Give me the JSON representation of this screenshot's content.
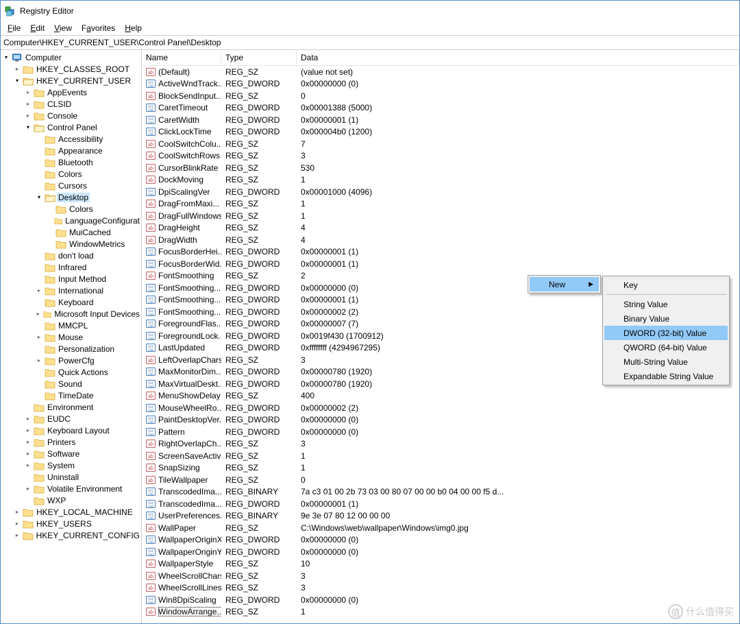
{
  "window": {
    "title": "Registry Editor"
  },
  "menu": {
    "file": "File",
    "edit": "Edit",
    "view": "View",
    "favorites": "Favorites",
    "help": "Help"
  },
  "addressbar": "Computer\\HKEY_CURRENT_USER\\Control Panel\\Desktop",
  "tree": {
    "root": "Computer",
    "hkcr": "HKEY_CLASSES_ROOT",
    "hkcu": "HKEY_CURRENT_USER",
    "hkcu_children": [
      "AppEvents",
      "CLSID",
      "Console"
    ],
    "control_panel": "Control Panel",
    "cp_children_pre": [
      "Accessibility",
      "Appearance",
      "Bluetooth",
      "Colors",
      "Cursors"
    ],
    "desktop": "Desktop",
    "desktop_children": [
      "Colors",
      "LanguageConfigurat",
      "MuiCached",
      "WindowMetrics"
    ],
    "cp_children_post": [
      "don't load",
      "Infrared",
      "Input Method",
      "International",
      "Keyboard",
      "Microsoft Input Devices",
      "MMCPL",
      "Mouse",
      "Personalization",
      "PowerCfg",
      "Quick Actions",
      "Sound",
      "TimeDate"
    ],
    "hkcu_children_post": [
      "Environment",
      "EUDC",
      "Keyboard Layout",
      "Printers",
      "Software",
      "System",
      "Uninstall",
      "Volatile Environment",
      "WXP"
    ],
    "hklm": "HKEY_LOCAL_MACHINE",
    "hku": "HKEY_USERS",
    "hkcc": "HKEY_CURRENT_CONFIG",
    "expandables_post": {
      "EUDC": true,
      "Keyboard Layout": true,
      "Printers": true,
      "Software": true,
      "System": true,
      "Volatile Environment": true
    },
    "cp_expandables_post": {
      "International": true,
      "Microsoft Input Devices": true,
      "Mouse": true,
      "PowerCfg": true
    }
  },
  "columns": {
    "name": "Name",
    "type": "Type",
    "data": "Data"
  },
  "values": [
    {
      "icon": "ab",
      "name": "(Default)",
      "type": "REG_SZ",
      "data": "(value not set)"
    },
    {
      "icon": "bin",
      "name": "ActiveWndTrack...",
      "type": "REG_DWORD",
      "data": "0x00000000 (0)"
    },
    {
      "icon": "ab",
      "name": "BlockSendInput...",
      "type": "REG_SZ",
      "data": "0"
    },
    {
      "icon": "bin",
      "name": "CaretTimeout",
      "type": "REG_DWORD",
      "data": "0x00001388 (5000)"
    },
    {
      "icon": "bin",
      "name": "CaretWidth",
      "type": "REG_DWORD",
      "data": "0x00000001 (1)"
    },
    {
      "icon": "bin",
      "name": "ClickLockTime",
      "type": "REG_DWORD",
      "data": "0x000004b0 (1200)"
    },
    {
      "icon": "ab",
      "name": "CoolSwitchColu...",
      "type": "REG_SZ",
      "data": "7"
    },
    {
      "icon": "ab",
      "name": "CoolSwitchRows",
      "type": "REG_SZ",
      "data": "3"
    },
    {
      "icon": "ab",
      "name": "CursorBlinkRate",
      "type": "REG_SZ",
      "data": "530"
    },
    {
      "icon": "ab",
      "name": "DockMoving",
      "type": "REG_SZ",
      "data": "1"
    },
    {
      "icon": "bin",
      "name": "DpiScalingVer",
      "type": "REG_DWORD",
      "data": "0x00001000 (4096)"
    },
    {
      "icon": "ab",
      "name": "DragFromMaxi...",
      "type": "REG_SZ",
      "data": "1"
    },
    {
      "icon": "ab",
      "name": "DragFullWindows",
      "type": "REG_SZ",
      "data": "1"
    },
    {
      "icon": "ab",
      "name": "DragHeight",
      "type": "REG_SZ",
      "data": "4"
    },
    {
      "icon": "ab",
      "name": "DragWidth",
      "type": "REG_SZ",
      "data": "4"
    },
    {
      "icon": "bin",
      "name": "FocusBorderHei...",
      "type": "REG_DWORD",
      "data": "0x00000001 (1)"
    },
    {
      "icon": "bin",
      "name": "FocusBorderWid...",
      "type": "REG_DWORD",
      "data": "0x00000001 (1)"
    },
    {
      "icon": "ab",
      "name": "FontSmoothing",
      "type": "REG_SZ",
      "data": "2"
    },
    {
      "icon": "bin",
      "name": "FontSmoothing...",
      "type": "REG_DWORD",
      "data": "0x00000000 (0)"
    },
    {
      "icon": "bin",
      "name": "FontSmoothing...",
      "type": "REG_DWORD",
      "data": "0x00000001 (1)"
    },
    {
      "icon": "bin",
      "name": "FontSmoothing...",
      "type": "REG_DWORD",
      "data": "0x00000002 (2)"
    },
    {
      "icon": "bin",
      "name": "ForegroundFlas...",
      "type": "REG_DWORD",
      "data": "0x00000007 (7)"
    },
    {
      "icon": "bin",
      "name": "ForegroundLock...",
      "type": "REG_DWORD",
      "data": "0x0019f430 (1700912)"
    },
    {
      "icon": "bin",
      "name": "LastUpdated",
      "type": "REG_DWORD",
      "data": "0xffffffff (4294967295)"
    },
    {
      "icon": "ab",
      "name": "LeftOverlapChars",
      "type": "REG_SZ",
      "data": "3"
    },
    {
      "icon": "bin",
      "name": "MaxMonitorDim...",
      "type": "REG_DWORD",
      "data": "0x00000780 (1920)"
    },
    {
      "icon": "bin",
      "name": "MaxVirtualDeskt...",
      "type": "REG_DWORD",
      "data": "0x00000780 (1920)"
    },
    {
      "icon": "ab",
      "name": "MenuShowDelay",
      "type": "REG_SZ",
      "data": "400"
    },
    {
      "icon": "bin",
      "name": "MouseWheelRo...",
      "type": "REG_DWORD",
      "data": "0x00000002 (2)"
    },
    {
      "icon": "bin",
      "name": "PaintDesktopVer...",
      "type": "REG_DWORD",
      "data": "0x00000000 (0)"
    },
    {
      "icon": "bin",
      "name": "Pattern",
      "type": "REG_DWORD",
      "data": "0x00000000 (0)"
    },
    {
      "icon": "ab",
      "name": "RightOverlapCh...",
      "type": "REG_SZ",
      "data": "3"
    },
    {
      "icon": "ab",
      "name": "ScreenSaveActive",
      "type": "REG_SZ",
      "data": "1"
    },
    {
      "icon": "ab",
      "name": "SnapSizing",
      "type": "REG_SZ",
      "data": "1"
    },
    {
      "icon": "ab",
      "name": "TileWallpaper",
      "type": "REG_SZ",
      "data": "0"
    },
    {
      "icon": "bin",
      "name": "TranscodedIma...",
      "type": "REG_BINARY",
      "data": "7a c3 01 00 2b 73 03 00 80 07 00 00 b0 04 00 00 f5 d..."
    },
    {
      "icon": "bin",
      "name": "TranscodedIma...",
      "type": "REG_DWORD",
      "data": "0x00000001 (1)"
    },
    {
      "icon": "bin",
      "name": "UserPreferences...",
      "type": "REG_BINARY",
      "data": "9e 3e 07 80 12 00 00 00"
    },
    {
      "icon": "ab",
      "name": "WallPaper",
      "type": "REG_SZ",
      "data": "C:\\Windows\\web\\wallpaper\\Windows\\img0.jpg"
    },
    {
      "icon": "bin",
      "name": "WallpaperOriginX",
      "type": "REG_DWORD",
      "data": "0x00000000 (0)"
    },
    {
      "icon": "bin",
      "name": "WallpaperOriginY",
      "type": "REG_DWORD",
      "data": "0x00000000 (0)"
    },
    {
      "icon": "ab",
      "name": "WallpaperStyle",
      "type": "REG_SZ",
      "data": "10"
    },
    {
      "icon": "ab",
      "name": "WheelScrollChars",
      "type": "REG_SZ",
      "data": "3"
    },
    {
      "icon": "ab",
      "name": "WheelScrollLines",
      "type": "REG_SZ",
      "data": "3"
    },
    {
      "icon": "bin",
      "name": "Win8DpiScaling",
      "type": "REG_DWORD",
      "data": "0x00000000 (0)"
    },
    {
      "icon": "ab",
      "name": "WindowArrange...",
      "type": "REG_SZ",
      "data": "1",
      "focused": true
    }
  ],
  "context_menu_1": {
    "new": "New"
  },
  "context_menu_2": {
    "key": "Key",
    "string": "String Value",
    "binary": "Binary Value",
    "dword": "DWORD (32-bit) Value",
    "qword": "QWORD (64-bit) Value",
    "multi": "Multi-String Value",
    "expand": "Expandable String Value"
  },
  "watermark": "什么值得买"
}
